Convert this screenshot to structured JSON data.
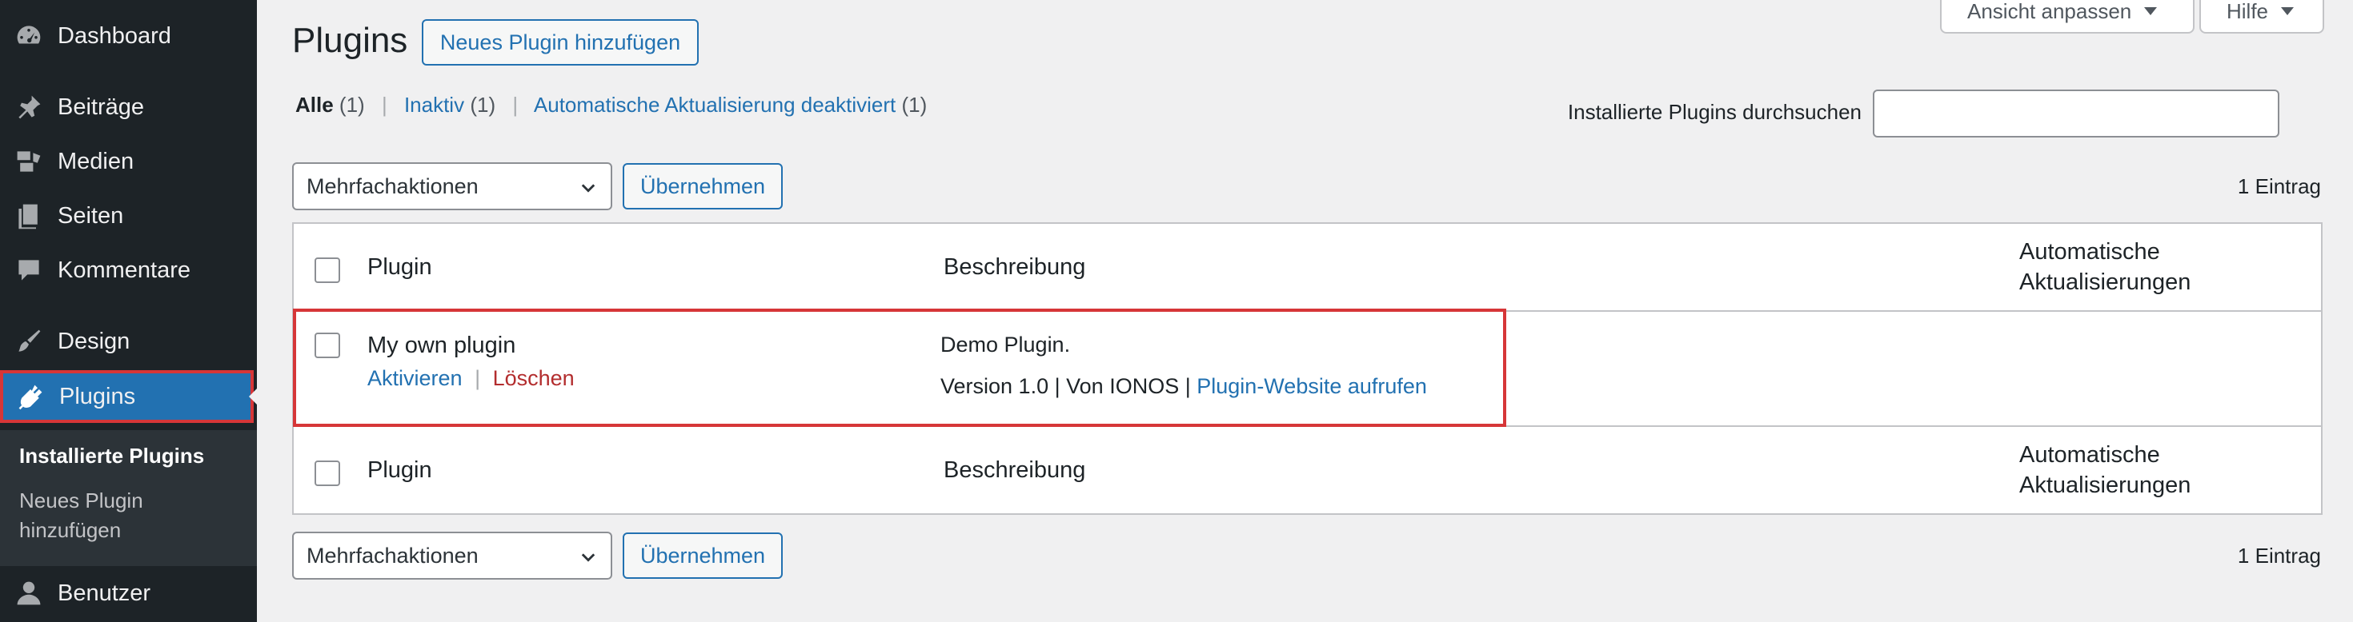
{
  "sidebar": {
    "items": [
      {
        "label": "Dashboard",
        "icon": "dashboard-icon"
      },
      {
        "label": "Beiträge",
        "icon": "pin-icon"
      },
      {
        "label": "Medien",
        "icon": "media-icon"
      },
      {
        "label": "Seiten",
        "icon": "pages-icon"
      },
      {
        "label": "Kommentare",
        "icon": "comment-icon"
      },
      {
        "label": "Design",
        "icon": "brush-icon"
      },
      {
        "label": "Plugins",
        "icon": "plugin-icon"
      },
      {
        "label": "Benutzer",
        "icon": "user-icon"
      }
    ],
    "submenu": {
      "installed": "Installierte Plugins",
      "add_new": "Neues Plugin hinzufügen"
    }
  },
  "screen_options": {
    "label": "Ansicht anpassen"
  },
  "help": {
    "label": "Hilfe"
  },
  "page": {
    "title": "Plugins",
    "add_new_button": "Neues Plugin hinzufügen"
  },
  "filters": {
    "all": {
      "label": "Alle",
      "count": "(1)"
    },
    "inactive": {
      "label": "Inaktiv",
      "count": "(1)"
    },
    "autoupdate_disabled": {
      "label": "Automatische Aktualisierung deaktiviert",
      "count": "(1)"
    },
    "separator": "|"
  },
  "search": {
    "label": "Installierte Plugins durchsuchen",
    "value": ""
  },
  "bulk": {
    "select_value": "Mehrfachaktionen",
    "apply_label": "Übernehmen",
    "count": "1 Eintrag"
  },
  "table": {
    "columns": {
      "plugin": "Plugin",
      "description": "Beschreibung",
      "auto_updates": "Automatische Aktualisierungen"
    },
    "rows": [
      {
        "name": "My own plugin",
        "actions": {
          "activate": "Aktivieren",
          "delete": "Löschen",
          "separator": "|"
        },
        "description": "Demo Plugin.",
        "version": "Version 1.0",
        "by": "Von IONOS",
        "website_link": "Plugin-Website aufrufen",
        "meta_separator": "|"
      }
    ]
  },
  "colors": {
    "sidebar_bg": "#1d2327",
    "accent": "#2271b1",
    "highlight": "#d63638",
    "delete": "#b32d2e"
  }
}
